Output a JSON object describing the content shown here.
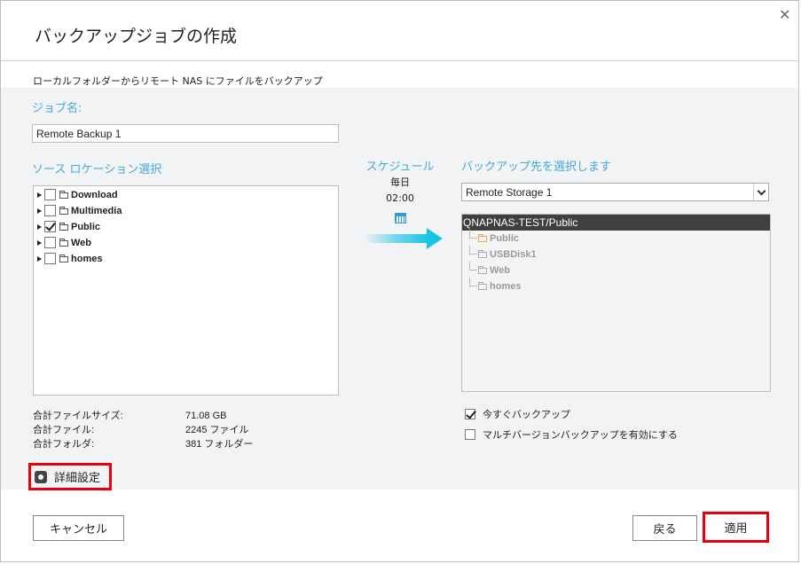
{
  "dialog": {
    "title": "バックアップジョブの作成",
    "description": "ローカルフォルダーからリモート NAS にファイルをバックアップ"
  },
  "job": {
    "label": "ジョブ名:",
    "value": "Remote Backup 1"
  },
  "source": {
    "label": "ソース ロケーション選択",
    "folders": [
      {
        "name": "Download",
        "checked": false
      },
      {
        "name": "Multimedia",
        "checked": false
      },
      {
        "name": "Public",
        "checked": true
      },
      {
        "name": "Web",
        "checked": false
      },
      {
        "name": "homes",
        "checked": false
      }
    ]
  },
  "stats": {
    "labels": [
      "合計ファイルサイズ:",
      "合計ファイル:",
      "合計フォルダ:"
    ],
    "values": [
      "71.08 GB",
      "2245 ファイル",
      "381 フォルダー"
    ]
  },
  "advanced": {
    "label": "詳細設定"
  },
  "schedule": {
    "label": "スケジュール",
    "frequency": "毎日",
    "time": "02:00"
  },
  "destination": {
    "label": "バックアップ先を選択します",
    "selected": "Remote Storage 1",
    "path": "QNAPNAS-TEST/Public",
    "folders": [
      "Public",
      "USBDisk1",
      "Web",
      "homes"
    ]
  },
  "options": [
    {
      "label": "今すぐバックアップ",
      "checked": true
    },
    {
      "label": "マルチバージョンバックアップを有効にする",
      "checked": false
    }
  ],
  "buttons": {
    "cancel": "キャンセル",
    "back": "戻る",
    "apply": "適用"
  },
  "colors": {
    "accent": "#45a9d6",
    "highlight": "#e8000d",
    "arrow": "#19c3e6"
  }
}
